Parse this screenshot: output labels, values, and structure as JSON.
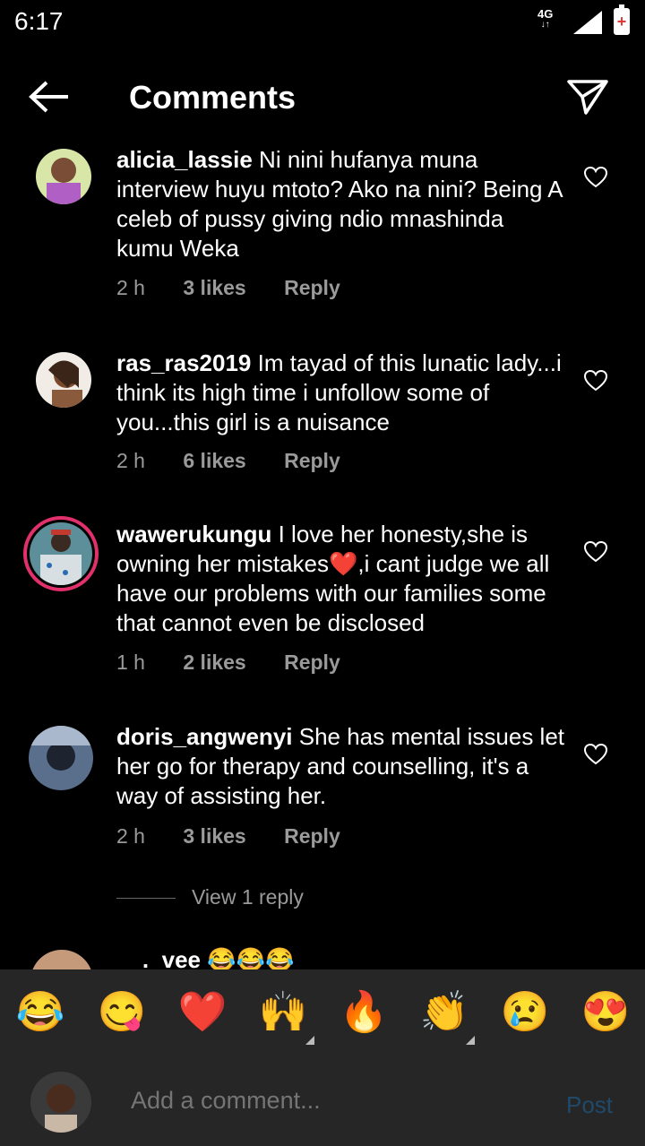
{
  "status": {
    "time": "6:17",
    "network": "4G"
  },
  "header": {
    "title": "Comments"
  },
  "comments": [
    {
      "username": "alicia_lassie",
      "text": "Ni nini hufanya muna interview huyu mtoto?  Ako na nini? Being A celeb of pussy giving ndio mnashinda kumu Weka",
      "time": "2 h",
      "likes": "3 likes",
      "reply": "Reply"
    },
    {
      "username": "ras_ras2019",
      "text": "Im tayad of this lunatic lady...i think its high time i unfollow some of you...this girl is a nuisance",
      "time": "2 h",
      "likes": "6 likes",
      "reply": "Reply"
    },
    {
      "username": "waweru­kungu",
      "text": "I love her honesty,she is owning her mistakes❤️,i cant  judge we all have  our problems with our families some that cannot even be disclosed",
      "time": "1 h",
      "likes": "2 likes",
      "reply": "Reply"
    },
    {
      "username": "doris_angwenyi",
      "text": "She has mental issues let her go for therapy and counselling, it's a way of assisting her.",
      "time": "2 h",
      "likes": "3 likes",
      "reply": "Reply"
    }
  ],
  "view_replies": "View 1 reply",
  "partial_comment": {
    "text": "__._vee 😂😂😂"
  },
  "emoji_bar": [
    "😂",
    "😋",
    "❤️",
    "🙌",
    "🔥",
    "👏",
    "😢",
    "😍"
  ],
  "composer": {
    "placeholder": "Add a comment...",
    "post_label": "Post"
  },
  "colors": {
    "background": "#000000",
    "bar": "#262626",
    "muted": "#9a9a9a",
    "post_disabled": "#1f4a6b"
  }
}
